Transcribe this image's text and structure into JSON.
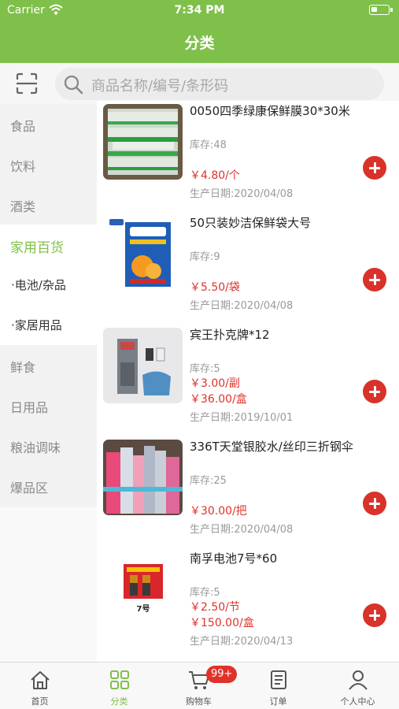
{
  "status": {
    "carrier": "Carrier",
    "time": "7:34 PM"
  },
  "nav": {
    "title": "分类"
  },
  "search": {
    "placeholder": "商品名称/编号/条形码"
  },
  "sidebar": {
    "items": [
      {
        "label": "食品",
        "state": "normal"
      },
      {
        "label": "饮料",
        "state": "normal"
      },
      {
        "label": "酒类",
        "state": "normal"
      },
      {
        "label": "家用百货",
        "state": "active"
      },
      {
        "label": "·电池/杂品",
        "state": "sub"
      },
      {
        "label": "·家居用品",
        "state": "sub"
      },
      {
        "label": "鲜食",
        "state": "normal"
      },
      {
        "label": "日用品",
        "state": "normal"
      },
      {
        "label": "粮油调味",
        "state": "normal"
      },
      {
        "label": "爆品区",
        "state": "normal"
      }
    ]
  },
  "products": [
    {
      "name": "0050四季绿康保鲜膜30*30米",
      "stock": "库存:48",
      "prices": [
        "￥4.80/个"
      ],
      "date": "生产日期:2020/04/08",
      "image": "cling-film-rolls"
    },
    {
      "name": "50只装妙洁保鲜袋大号",
      "stock": "库存:9",
      "prices": [
        "￥5.50/袋"
      ],
      "date": "生产日期:2020/04/08",
      "image": "freshness-bag-pack"
    },
    {
      "name": "宾王扑克牌*12",
      "stock": "库存:5",
      "prices": [
        "￥3.00/副",
        "￥36.00/盒"
      ],
      "date": "生产日期:2019/10/01",
      "image": "playing-cards"
    },
    {
      "name": "336T天堂银胶水/丝印三折钢伞",
      "stock": "库存:25",
      "prices": [
        "￥30.00/把"
      ],
      "date": "生产日期:2020/04/08",
      "image": "folding-umbrellas"
    },
    {
      "name": "南孚电池7号*60",
      "stock": "库存:5",
      "prices": [
        "￥2.50/节",
        "￥150.00/盒"
      ],
      "date": "生产日期:2020/04/13",
      "image": "battery-pack"
    }
  ],
  "tabs": [
    {
      "label": "首页",
      "icon": "home-icon"
    },
    {
      "label": "分类",
      "icon": "grid-icon"
    },
    {
      "label": "购物车",
      "icon": "cart-icon"
    },
    {
      "label": "订单",
      "icon": "order-icon"
    },
    {
      "label": "个人中心",
      "icon": "person-icon"
    }
  ],
  "cart_badge": "99+",
  "colors": {
    "brand": "#7fc04a",
    "price": "#e0322b",
    "add_button": "#d8322a"
  }
}
